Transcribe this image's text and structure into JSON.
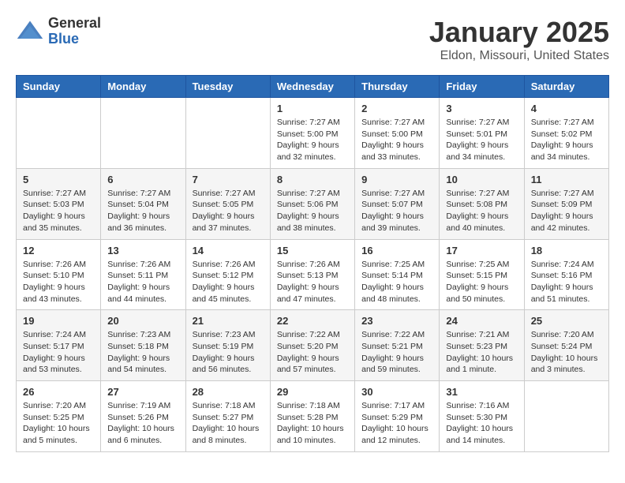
{
  "header": {
    "logo_general": "General",
    "logo_blue": "Blue",
    "month_title": "January 2025",
    "location": "Eldon, Missouri, United States"
  },
  "weekdays": [
    "Sunday",
    "Monday",
    "Tuesday",
    "Wednesday",
    "Thursday",
    "Friday",
    "Saturday"
  ],
  "weeks": [
    [
      {
        "day": "",
        "info": ""
      },
      {
        "day": "",
        "info": ""
      },
      {
        "day": "",
        "info": ""
      },
      {
        "day": "1",
        "info": "Sunrise: 7:27 AM\nSunset: 5:00 PM\nDaylight: 9 hours\nand 32 minutes."
      },
      {
        "day": "2",
        "info": "Sunrise: 7:27 AM\nSunset: 5:00 PM\nDaylight: 9 hours\nand 33 minutes."
      },
      {
        "day": "3",
        "info": "Sunrise: 7:27 AM\nSunset: 5:01 PM\nDaylight: 9 hours\nand 34 minutes."
      },
      {
        "day": "4",
        "info": "Sunrise: 7:27 AM\nSunset: 5:02 PM\nDaylight: 9 hours\nand 34 minutes."
      }
    ],
    [
      {
        "day": "5",
        "info": "Sunrise: 7:27 AM\nSunset: 5:03 PM\nDaylight: 9 hours\nand 35 minutes."
      },
      {
        "day": "6",
        "info": "Sunrise: 7:27 AM\nSunset: 5:04 PM\nDaylight: 9 hours\nand 36 minutes."
      },
      {
        "day": "7",
        "info": "Sunrise: 7:27 AM\nSunset: 5:05 PM\nDaylight: 9 hours\nand 37 minutes."
      },
      {
        "day": "8",
        "info": "Sunrise: 7:27 AM\nSunset: 5:06 PM\nDaylight: 9 hours\nand 38 minutes."
      },
      {
        "day": "9",
        "info": "Sunrise: 7:27 AM\nSunset: 5:07 PM\nDaylight: 9 hours\nand 39 minutes."
      },
      {
        "day": "10",
        "info": "Sunrise: 7:27 AM\nSunset: 5:08 PM\nDaylight: 9 hours\nand 40 minutes."
      },
      {
        "day": "11",
        "info": "Sunrise: 7:27 AM\nSunset: 5:09 PM\nDaylight: 9 hours\nand 42 minutes."
      }
    ],
    [
      {
        "day": "12",
        "info": "Sunrise: 7:26 AM\nSunset: 5:10 PM\nDaylight: 9 hours\nand 43 minutes."
      },
      {
        "day": "13",
        "info": "Sunrise: 7:26 AM\nSunset: 5:11 PM\nDaylight: 9 hours\nand 44 minutes."
      },
      {
        "day": "14",
        "info": "Sunrise: 7:26 AM\nSunset: 5:12 PM\nDaylight: 9 hours\nand 45 minutes."
      },
      {
        "day": "15",
        "info": "Sunrise: 7:26 AM\nSunset: 5:13 PM\nDaylight: 9 hours\nand 47 minutes."
      },
      {
        "day": "16",
        "info": "Sunrise: 7:25 AM\nSunset: 5:14 PM\nDaylight: 9 hours\nand 48 minutes."
      },
      {
        "day": "17",
        "info": "Sunrise: 7:25 AM\nSunset: 5:15 PM\nDaylight: 9 hours\nand 50 minutes."
      },
      {
        "day": "18",
        "info": "Sunrise: 7:24 AM\nSunset: 5:16 PM\nDaylight: 9 hours\nand 51 minutes."
      }
    ],
    [
      {
        "day": "19",
        "info": "Sunrise: 7:24 AM\nSunset: 5:17 PM\nDaylight: 9 hours\nand 53 minutes."
      },
      {
        "day": "20",
        "info": "Sunrise: 7:23 AM\nSunset: 5:18 PM\nDaylight: 9 hours\nand 54 minutes."
      },
      {
        "day": "21",
        "info": "Sunrise: 7:23 AM\nSunset: 5:19 PM\nDaylight: 9 hours\nand 56 minutes."
      },
      {
        "day": "22",
        "info": "Sunrise: 7:22 AM\nSunset: 5:20 PM\nDaylight: 9 hours\nand 57 minutes."
      },
      {
        "day": "23",
        "info": "Sunrise: 7:22 AM\nSunset: 5:21 PM\nDaylight: 9 hours\nand 59 minutes."
      },
      {
        "day": "24",
        "info": "Sunrise: 7:21 AM\nSunset: 5:23 PM\nDaylight: 10 hours\nand 1 minute."
      },
      {
        "day": "25",
        "info": "Sunrise: 7:20 AM\nSunset: 5:24 PM\nDaylight: 10 hours\nand 3 minutes."
      }
    ],
    [
      {
        "day": "26",
        "info": "Sunrise: 7:20 AM\nSunset: 5:25 PM\nDaylight: 10 hours\nand 5 minutes."
      },
      {
        "day": "27",
        "info": "Sunrise: 7:19 AM\nSunset: 5:26 PM\nDaylight: 10 hours\nand 6 minutes."
      },
      {
        "day": "28",
        "info": "Sunrise: 7:18 AM\nSunset: 5:27 PM\nDaylight: 10 hours\nand 8 minutes."
      },
      {
        "day": "29",
        "info": "Sunrise: 7:18 AM\nSunset: 5:28 PM\nDaylight: 10 hours\nand 10 minutes."
      },
      {
        "day": "30",
        "info": "Sunrise: 7:17 AM\nSunset: 5:29 PM\nDaylight: 10 hours\nand 12 minutes."
      },
      {
        "day": "31",
        "info": "Sunrise: 7:16 AM\nSunset: 5:30 PM\nDaylight: 10 hours\nand 14 minutes."
      },
      {
        "day": "",
        "info": ""
      }
    ]
  ]
}
